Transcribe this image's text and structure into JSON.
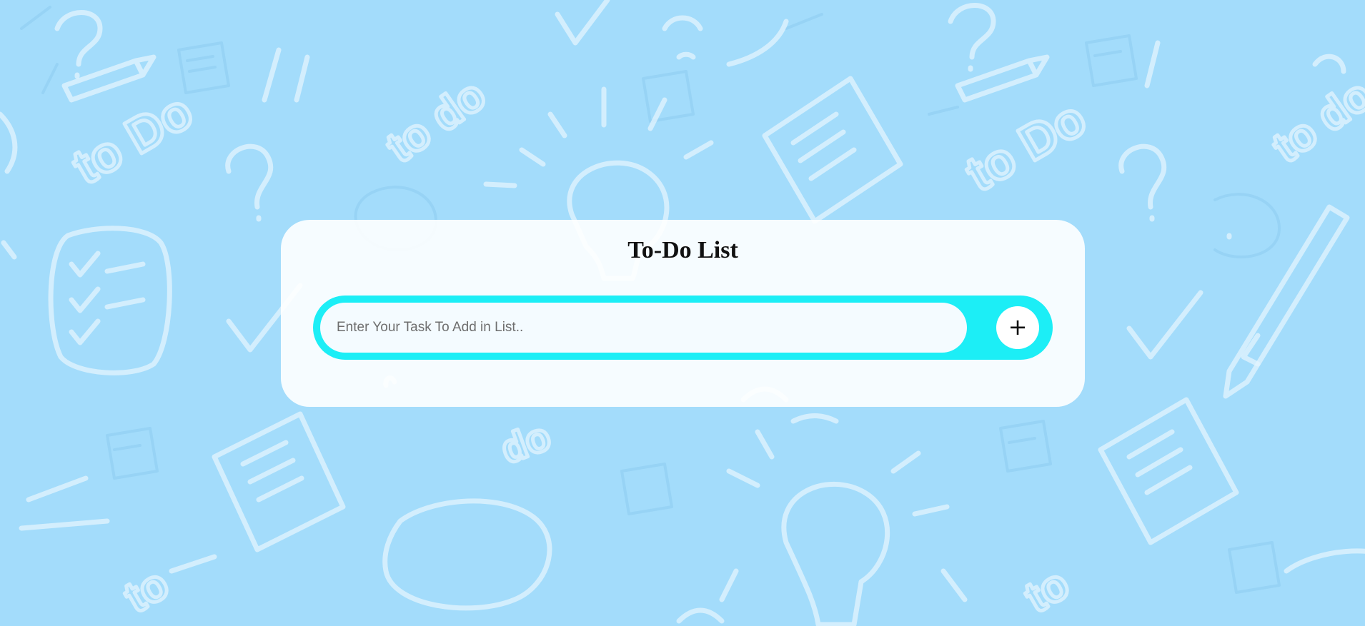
{
  "app": {
    "title": "To-Do List"
  },
  "task_input": {
    "value": "",
    "placeholder": "Enter Your Task To Add in List.."
  },
  "add_button": {
    "icon": "plus-icon",
    "glyph": "+"
  },
  "colors": {
    "background": "#a3dcfb",
    "doodle": "#e3f4fe",
    "card": "#ffffff",
    "input_border": "#1ceef6",
    "title_text": "#111111"
  }
}
